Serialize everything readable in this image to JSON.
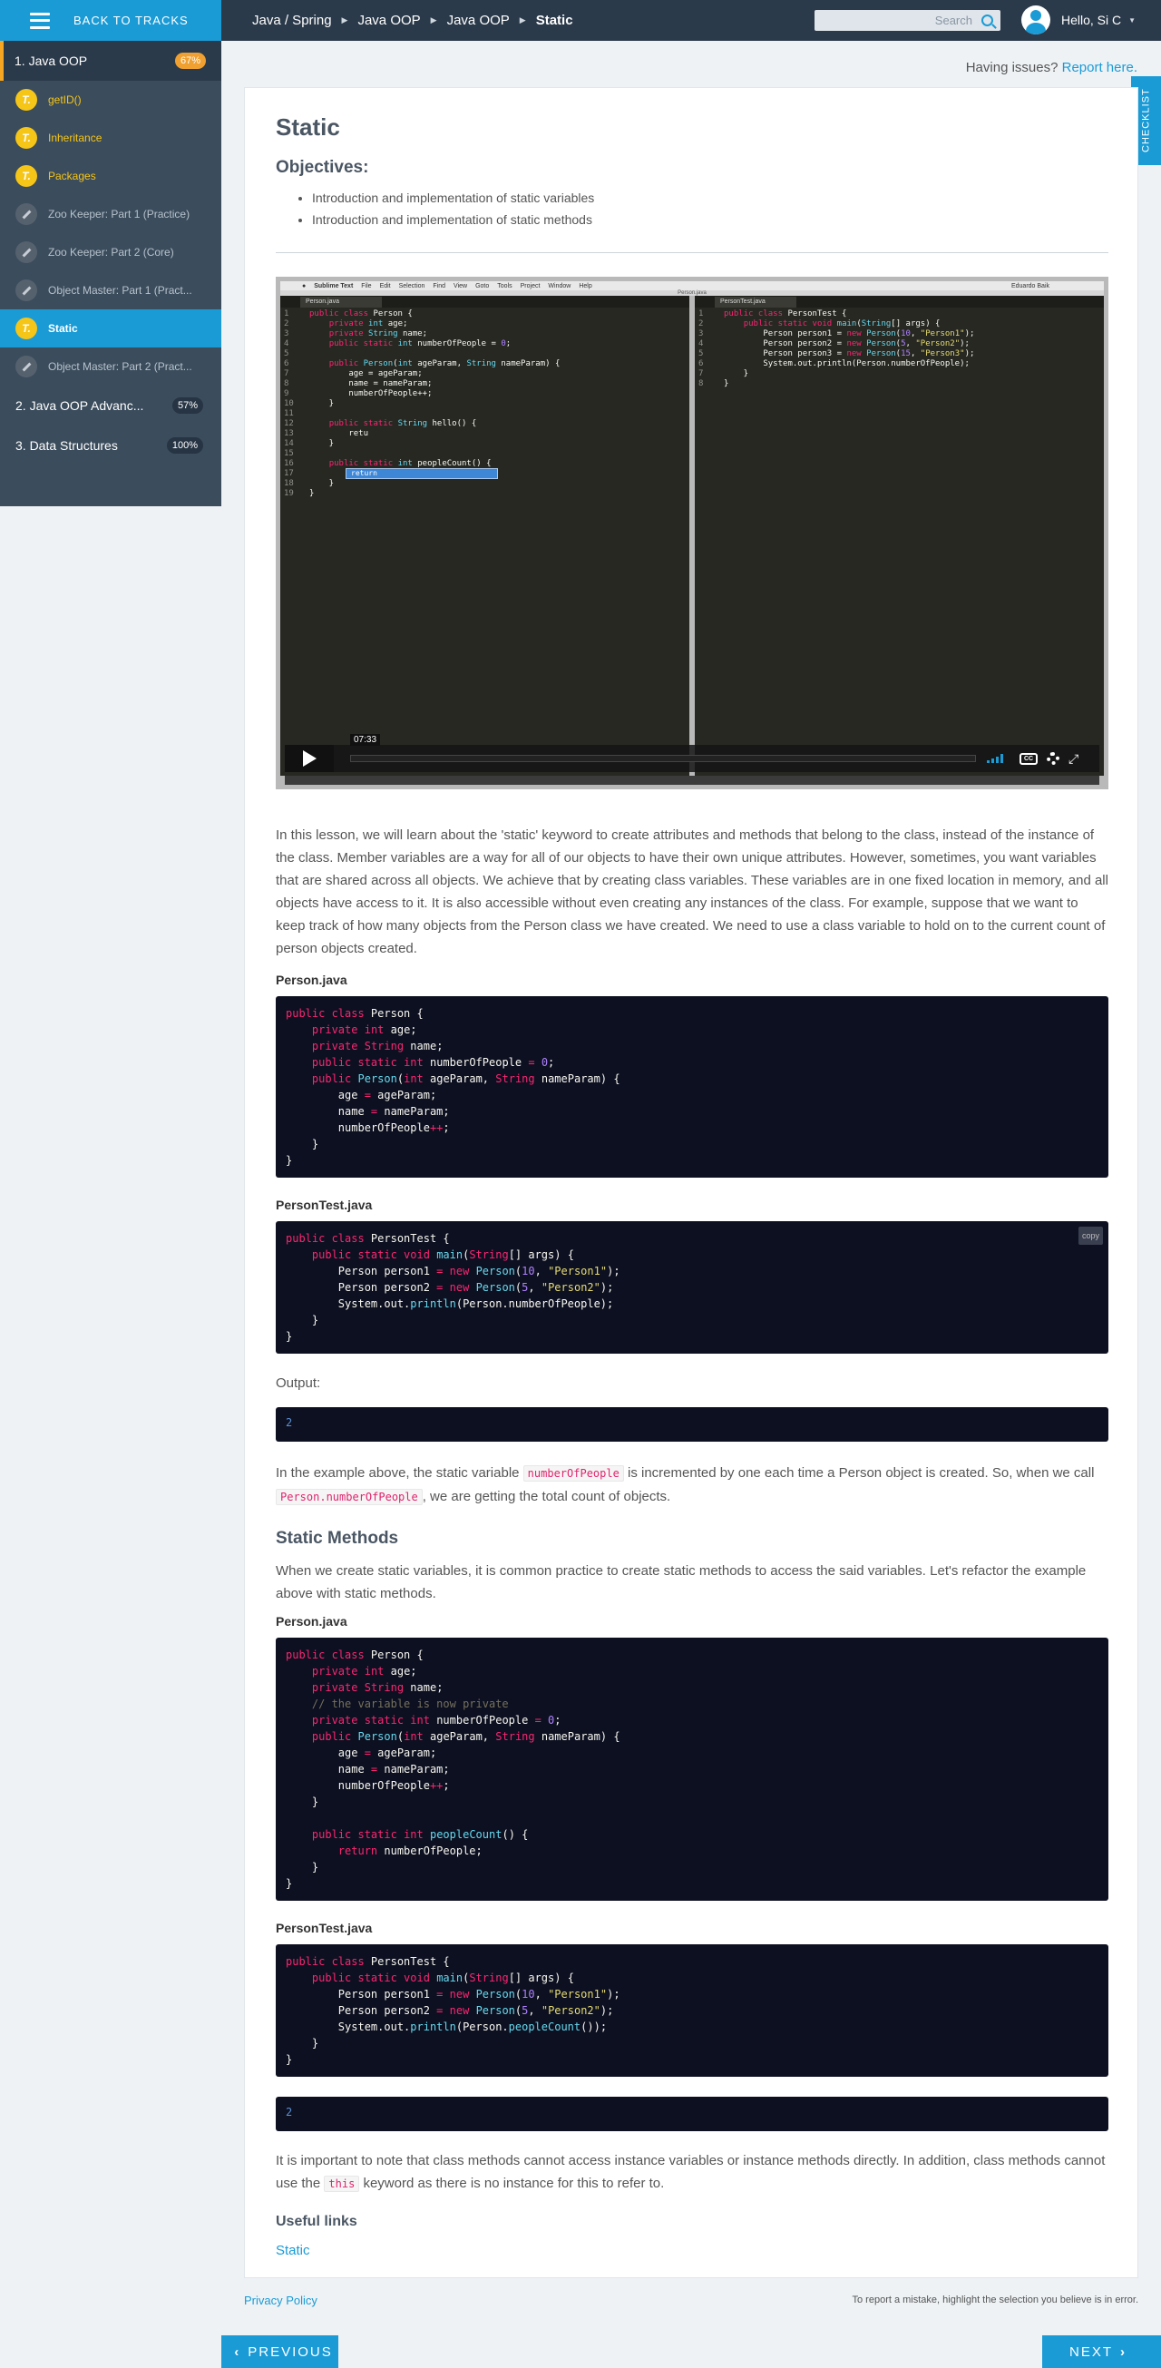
{
  "header": {
    "back_label": "BACK TO TRACKS",
    "breadcrumb": [
      "Java / Spring",
      "Java OOP",
      "Java OOP",
      "Static"
    ],
    "search_placeholder": "Search",
    "user_greeting": "Hello, Si C"
  },
  "sidebar": {
    "current_track": {
      "label": "1. Java OOP",
      "progress": "67%"
    },
    "items": [
      {
        "label": "getID()",
        "icon": "t-icon",
        "state": "gold"
      },
      {
        "label": "Inheritance",
        "icon": "t-icon",
        "state": "gold"
      },
      {
        "label": "Packages",
        "icon": "t-icon",
        "state": "gold"
      },
      {
        "label": "Zoo Keeper: Part 1 (Practice)",
        "icon": "pencil-icon",
        "state": "normal"
      },
      {
        "label": "Zoo Keeper: Part 2 (Core)",
        "icon": "pencil-icon",
        "state": "normal"
      },
      {
        "label": "Object Master: Part 1 (Pract...",
        "icon": "pencil-icon",
        "state": "normal"
      },
      {
        "label": "Static",
        "icon": "t-icon",
        "state": "active"
      },
      {
        "label": "Object Master: Part 2 (Pract...",
        "icon": "pencil-icon",
        "state": "normal"
      }
    ],
    "tracks": [
      {
        "label": "2. Java OOP Advanc...",
        "progress": "57%"
      },
      {
        "label": "3. Data Structures",
        "progress": "100%"
      }
    ]
  },
  "issues": {
    "text": "Having issues?",
    "link": "Report here."
  },
  "checklist_label": "CHECKLIST",
  "lesson": {
    "title": "Static",
    "objectives_heading": "Objectives:",
    "objectives": [
      "Introduction and implementation of static variables",
      "Introduction and implementation of static methods"
    ],
    "video": {
      "menu": [
        "Sublime Text",
        "File",
        "Edit",
        "Selection",
        "Find",
        "View",
        "Goto",
        "Tools",
        "Project",
        "Window",
        "Help"
      ],
      "window_title": "Person.java",
      "tab_left": "Person.java",
      "tab_right": "PersonTest.java",
      "mac_user": "Eduardo Baik",
      "autocomplete": "return",
      "timestamp": "07:33",
      "cc_label": "CC"
    },
    "intro": "In this lesson, we will learn about the 'static' keyword to create attributes and methods that belong to the class, instead of the instance of the class. Member variables are a way for all of our objects to have their own unique attributes. However, sometimes, you want variables that are shared across all objects. We achieve that by creating class variables. These variables are in one fixed location in memory, and all objects have access to it. It is also accessible without even creating any instances of the class. For example, suppose that we want to keep track of how many objects from the Person class we have created. We need to use a class variable to hold on to the current count of person objects created.",
    "file1_label": "Person.java",
    "file2_label": "PersonTest.java",
    "copy_label": "copy",
    "output_label": "Output:",
    "output_value": "2",
    "explain_pre": "In the example above, the static variable",
    "explain_code1": "numberOfPeople",
    "explain_mid": "is incremented by one each time a Person object is created. So, when we call",
    "explain_code2": "Person.numberOfPeople",
    "explain_post": ", we are getting the total count of objects.",
    "methods_heading": "Static Methods",
    "methods_intro": "When we create static variables, it is common practice to create static methods to access the said variables. Let's refactor the example above with static methods.",
    "file3_label": "Person.java",
    "file4_label": "PersonTest.java",
    "output2_value": "2",
    "note_pre": "It is important to note that class methods cannot access instance variables or instance methods directly. In addition, class methods cannot use the",
    "note_code": "this",
    "note_post": "keyword as there is no instance for this to refer to.",
    "links_heading": "Useful links",
    "links": [
      "Static"
    ]
  },
  "footer": {
    "privacy": "Privacy Policy",
    "report_hint": "To report a mistake, highlight the selection you believe is in error.",
    "prev_label": "PREVIOUS",
    "next_label": "NEXT"
  },
  "colors": {
    "accent": "#1a9bd6",
    "topbar": "#2b3a4a",
    "sidebar": "#3b4c5c",
    "gold": "#f5c518",
    "progress_badge": "#f0a030",
    "code_bg": "#0d1020"
  }
}
